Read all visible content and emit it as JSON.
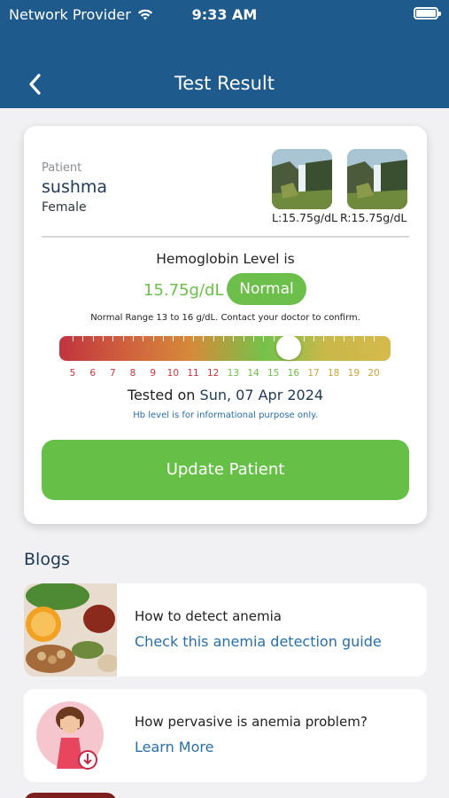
{
  "status_bar": {
    "carrier": "Network Provider",
    "time": "9:33 AM",
    "wifi_icon": "wifi-icon",
    "battery_icon": "battery-icon"
  },
  "header": {
    "title": "Test Result",
    "back_icon": "chevron-left-icon"
  },
  "patient": {
    "label": "Patient",
    "name": "sushma",
    "gender": "Female",
    "left_caption": "L:15.75g/dL",
    "right_caption": "R:15.75g/dL"
  },
  "result": {
    "heading": "Hemoglobin Level is",
    "value": "15.75g/dL",
    "status": "Normal",
    "range_note": "Normal Range 13 to 16 g/dL. Contact your doctor to confirm.",
    "scale_labels": [
      "5",
      "6",
      "7",
      "8",
      "9",
      "10",
      "11",
      "12",
      "13",
      "14",
      "15",
      "16",
      "17",
      "18",
      "19",
      "20"
    ],
    "scale_value": 15.75,
    "tested_prefix": "Tested on",
    "tested_date": "Sun, 07 Apr 2024",
    "info_note": "Hb level is for informational purpose only.",
    "update_button": "Update Patient"
  },
  "blogs": {
    "title": "Blogs",
    "items": [
      {
        "question": "How to detect anemia",
        "link": "Check this anemia detection guide"
      },
      {
        "question": "How pervasive is anemia problem?",
        "link": "Learn More"
      }
    ]
  },
  "colors": {
    "header": "#1f5a8c",
    "accent_green": "#66bf47",
    "link_blue": "#2a6ea8"
  }
}
